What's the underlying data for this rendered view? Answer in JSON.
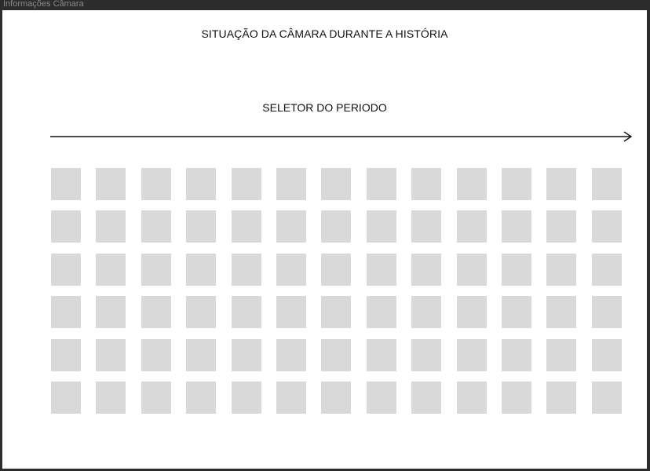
{
  "window": {
    "title": "Informações Câmara"
  },
  "page": {
    "title": "SITUAÇÃO DA CÂMARA DURANTE A HISTÓRIA",
    "period_selector_label": "SELETOR DO PERIODO"
  },
  "seat_grid": {
    "rows": 6,
    "columns": 13,
    "seat_color": "#d9d9d9"
  },
  "colors": {
    "background": "#ffffff",
    "outer": "#2c2c2c",
    "text": "#111111",
    "arrow": "#111111"
  }
}
